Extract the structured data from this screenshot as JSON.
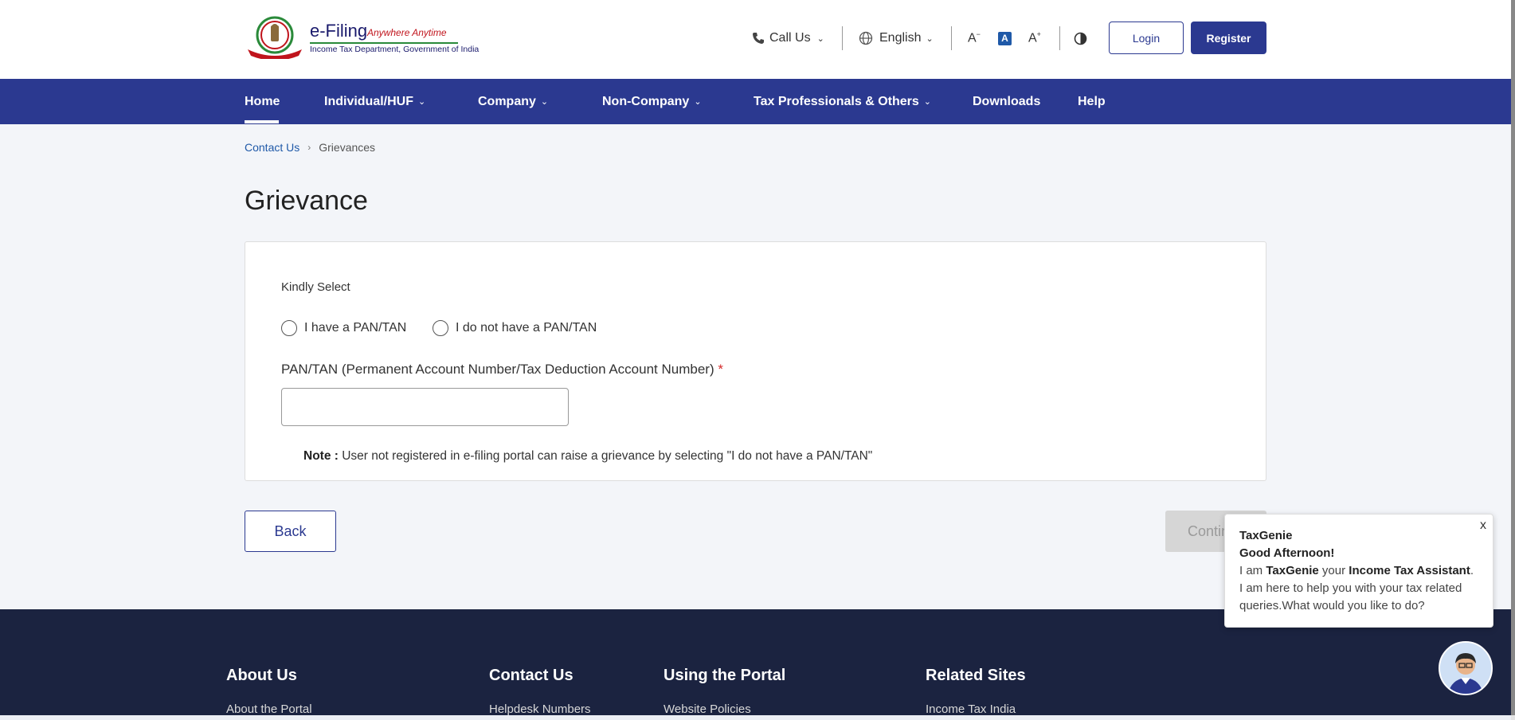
{
  "header": {
    "logo_title": "e-Filing",
    "logo_tagline": "Anywhere Anytime",
    "logo_subtitle": "Income Tax Department, Government of India",
    "call_us": "Call Us",
    "language": "English",
    "login": "Login",
    "register": "Register"
  },
  "nav": {
    "items": [
      {
        "label": "Home",
        "dropdown": false
      },
      {
        "label": "Individual/HUF",
        "dropdown": true
      },
      {
        "label": "Company",
        "dropdown": true
      },
      {
        "label": "Non-Company",
        "dropdown": true
      },
      {
        "label": "Tax Professionals & Others",
        "dropdown": true
      },
      {
        "label": "Downloads",
        "dropdown": false
      },
      {
        "label": "Help",
        "dropdown": false
      }
    ]
  },
  "breadcrumb": {
    "parent": "Contact Us",
    "current": "Grievances"
  },
  "page_title": "Grievance",
  "form": {
    "kindly_select": "Kindly Select",
    "option_have": "I have a PAN/TAN",
    "option_not_have": "I do not have a PAN/TAN",
    "field_label": "PAN/TAN (Permanent Account Number/Tax Deduction Account Number)",
    "required_mark": "*",
    "field_value": "",
    "note_label": "Note :",
    "note_text": "User not registered in e-filing portal can raise a grievance by selecting \"I do not have a PAN/TAN\""
  },
  "actions": {
    "back": "Back",
    "continue": "Continue"
  },
  "chat": {
    "title": "TaxGenie",
    "greeting": "Good Afternoon!",
    "msg_1": "I am ",
    "msg_name": "TaxGenie",
    "msg_2": " your ",
    "msg_role": "Income Tax Assistant",
    "msg_3": ". I am here to help you with your tax related queries.What would you like to do?",
    "close": "x"
  },
  "footer": {
    "columns": [
      {
        "heading": "About Us",
        "first_link": "About the Portal"
      },
      {
        "heading": "Contact Us",
        "first_link": "Helpdesk Numbers"
      },
      {
        "heading": "Using the Portal",
        "first_link": "Website Policies"
      },
      {
        "heading": "Related Sites",
        "first_link": "Income Tax India"
      }
    ]
  },
  "colors": {
    "primary": "#2b3990",
    "footer_bg": "#1b2340",
    "link": "#1f59a8",
    "required": "#d42a2a"
  }
}
